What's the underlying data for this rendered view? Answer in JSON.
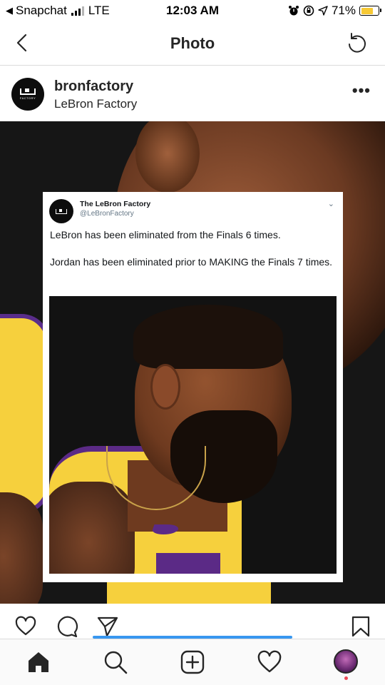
{
  "status_bar": {
    "back_app": "Snapchat",
    "network": "LTE",
    "time": "12:03 AM",
    "battery": "71%",
    "battery_level": 0.71,
    "battery_color": "#f7c935"
  },
  "header": {
    "title": "Photo",
    "back_icon": "chevron-left-icon",
    "refresh_icon": "refresh-icon"
  },
  "post": {
    "username": "bronfactory",
    "display_name": "LeBron Factory",
    "avatar_text": "FACTORY",
    "more_label": "•••"
  },
  "tweet": {
    "name": "The LeBron Factory",
    "handle": "@LeBronFactory",
    "chevron": "⌄",
    "line1": "LeBron has been eliminated from the Finals 6 times.",
    "line2": "Jordan has been eliminated prior to MAKING the Finals 7 times.",
    "avatar_text": "FACTORY"
  },
  "actions": {
    "icons": [
      "heart-icon",
      "comment-icon",
      "send-icon",
      "bookmark-icon"
    ]
  },
  "bottom_nav": {
    "items": [
      "home-icon",
      "search-icon",
      "add-post-icon",
      "activity-heart-icon",
      "profile-avatar"
    ]
  },
  "colors": {
    "accent_blue": "#3897f0",
    "jersey_gold": "#f6d03d",
    "jersey_purple": "#5b2a86",
    "notification_red": "#ed4956"
  }
}
